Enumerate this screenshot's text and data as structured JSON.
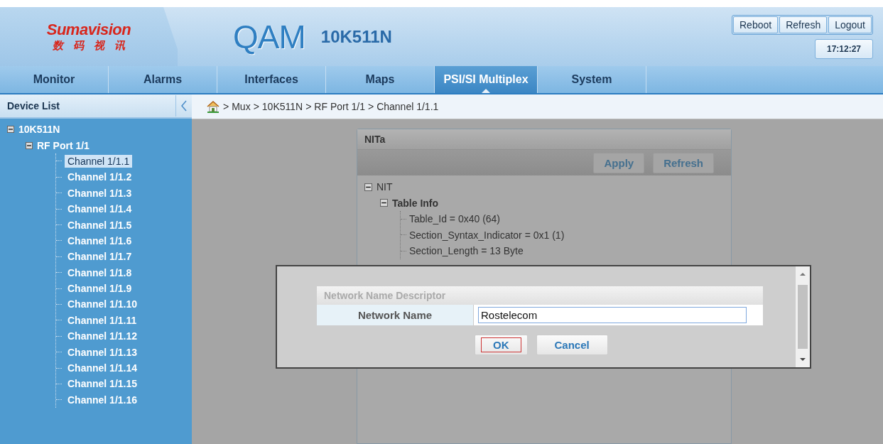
{
  "logo": {
    "brand": "Sumavision",
    "subtitle": "数码视讯"
  },
  "product": {
    "name": "QAM",
    "model": "10K511N"
  },
  "header_buttons": [
    "Reboot",
    "Refresh",
    "Logout"
  ],
  "clock": "17:12:27",
  "tabs": [
    {
      "label": "Monitor",
      "selected": false
    },
    {
      "label": "Alarms",
      "selected": false
    },
    {
      "label": "Interfaces",
      "selected": false
    },
    {
      "label": "Maps",
      "selected": false
    },
    {
      "label": "PSI/SI Multiplex",
      "selected": true
    },
    {
      "label": "System",
      "selected": false
    }
  ],
  "sidebar": {
    "title": "Device List",
    "tree": [
      {
        "label": "10K511N",
        "expanded": true,
        "selected": false,
        "children": [
          {
            "label": "RF Port 1/1",
            "expanded": true,
            "selected": false,
            "children": [
              {
                "label": "Channel 1/1.1",
                "selected": true
              },
              {
                "label": "Channel 1/1.2",
                "selected": false
              },
              {
                "label": "Channel 1/1.3",
                "selected": false
              },
              {
                "label": "Channel 1/1.4",
                "selected": false
              },
              {
                "label": "Channel 1/1.5",
                "selected": false
              },
              {
                "label": "Channel 1/1.6",
                "selected": false
              },
              {
                "label": "Channel 1/1.7",
                "selected": false
              },
              {
                "label": "Channel 1/1.8",
                "selected": false
              },
              {
                "label": "Channel 1/1.9",
                "selected": false
              },
              {
                "label": "Channel 1/1.10",
                "selected": false
              },
              {
                "label": "Channel 1/1.11",
                "selected": false
              },
              {
                "label": "Channel 1/1.12",
                "selected": false
              },
              {
                "label": "Channel 1/1.13",
                "selected": false
              },
              {
                "label": "Channel 1/1.14",
                "selected": false
              },
              {
                "label": "Channel 1/1.15",
                "selected": false
              },
              {
                "label": "Channel 1/1.16",
                "selected": false
              }
            ]
          }
        ]
      }
    ]
  },
  "breadcrumb": {
    "separator": ">",
    "items": [
      "Mux",
      "10K511N",
      "RF Port 1/1",
      "Channel 1/1.1"
    ]
  },
  "panel": {
    "title": "NITa",
    "buttons": [
      "Apply",
      "Refresh"
    ],
    "tree": [
      {
        "label": "NIT",
        "expanded": true,
        "bold": false,
        "children": [
          {
            "label": "Table Info",
            "expanded": true,
            "bold": true,
            "children": [
              {
                "label": "Table_Id = 0x40 (64)"
              },
              {
                "label": "Section_Syntax_Indicator = 0x1 (1)"
              },
              {
                "label": "Section_Length = 13 Byte"
              }
            ]
          }
        ]
      }
    ]
  },
  "dialog": {
    "section": "Network Name Descriptor",
    "field_label": "Network Name",
    "value": "Rostelecom",
    "buttons": [
      {
        "label": "OK",
        "focused": true
      },
      {
        "label": "Cancel",
        "focused": false
      }
    ]
  }
}
